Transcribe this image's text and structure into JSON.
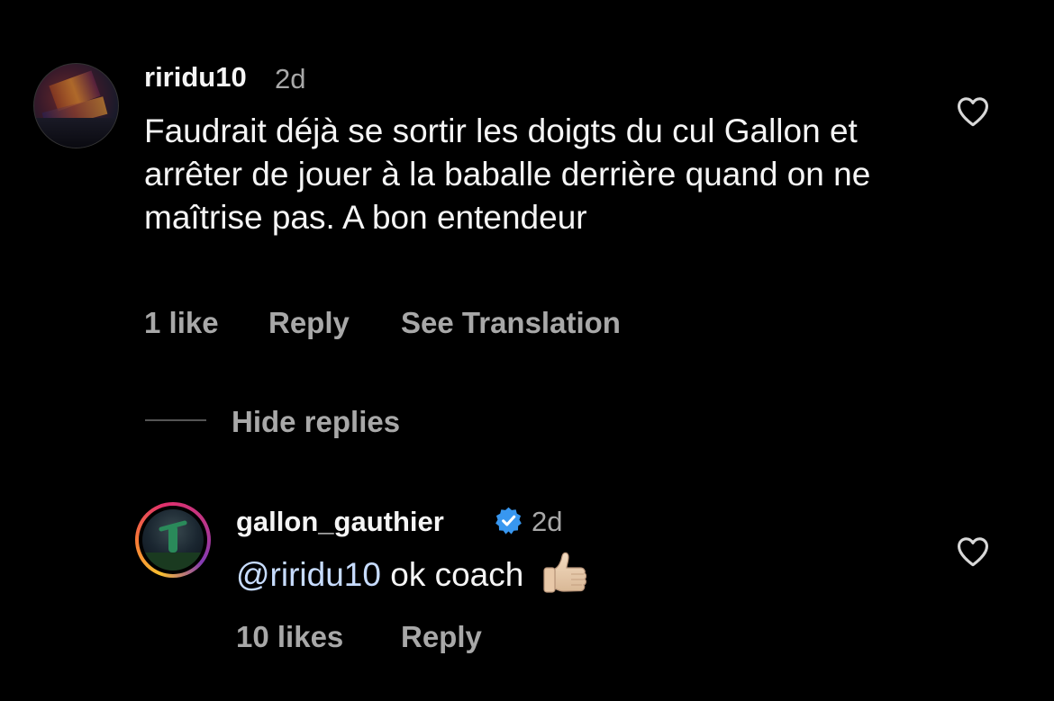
{
  "comment": {
    "username": "riridu10",
    "time": "2d",
    "text": "Faudrait déjà se sortir les doigts du cul Gallon et arrêter de jouer à la baballe derrière quand on ne maîtrise pas. A bon entendeur",
    "likes": "1 like",
    "reply_label": "Reply",
    "translate_label": "See Translation",
    "avatar_icon": "profile-photo-stadium",
    "like_icon": "heart-outline-icon"
  },
  "hide_replies_label": "Hide replies",
  "reply": {
    "username": "gallon_gauthier",
    "verified": true,
    "time": "2d",
    "mention": "@riridu10",
    "text": " ok coach",
    "emoji": "thumbs-up",
    "likes": "10 likes",
    "reply_label": "Reply",
    "avatar_icon": "profile-photo-player",
    "like_icon": "heart-outline-icon"
  },
  "colors": {
    "background": "#000000",
    "primary_text": "#f5f5f5",
    "secondary_text": "#a8a8a8",
    "verified_badge": "#3897f0"
  }
}
